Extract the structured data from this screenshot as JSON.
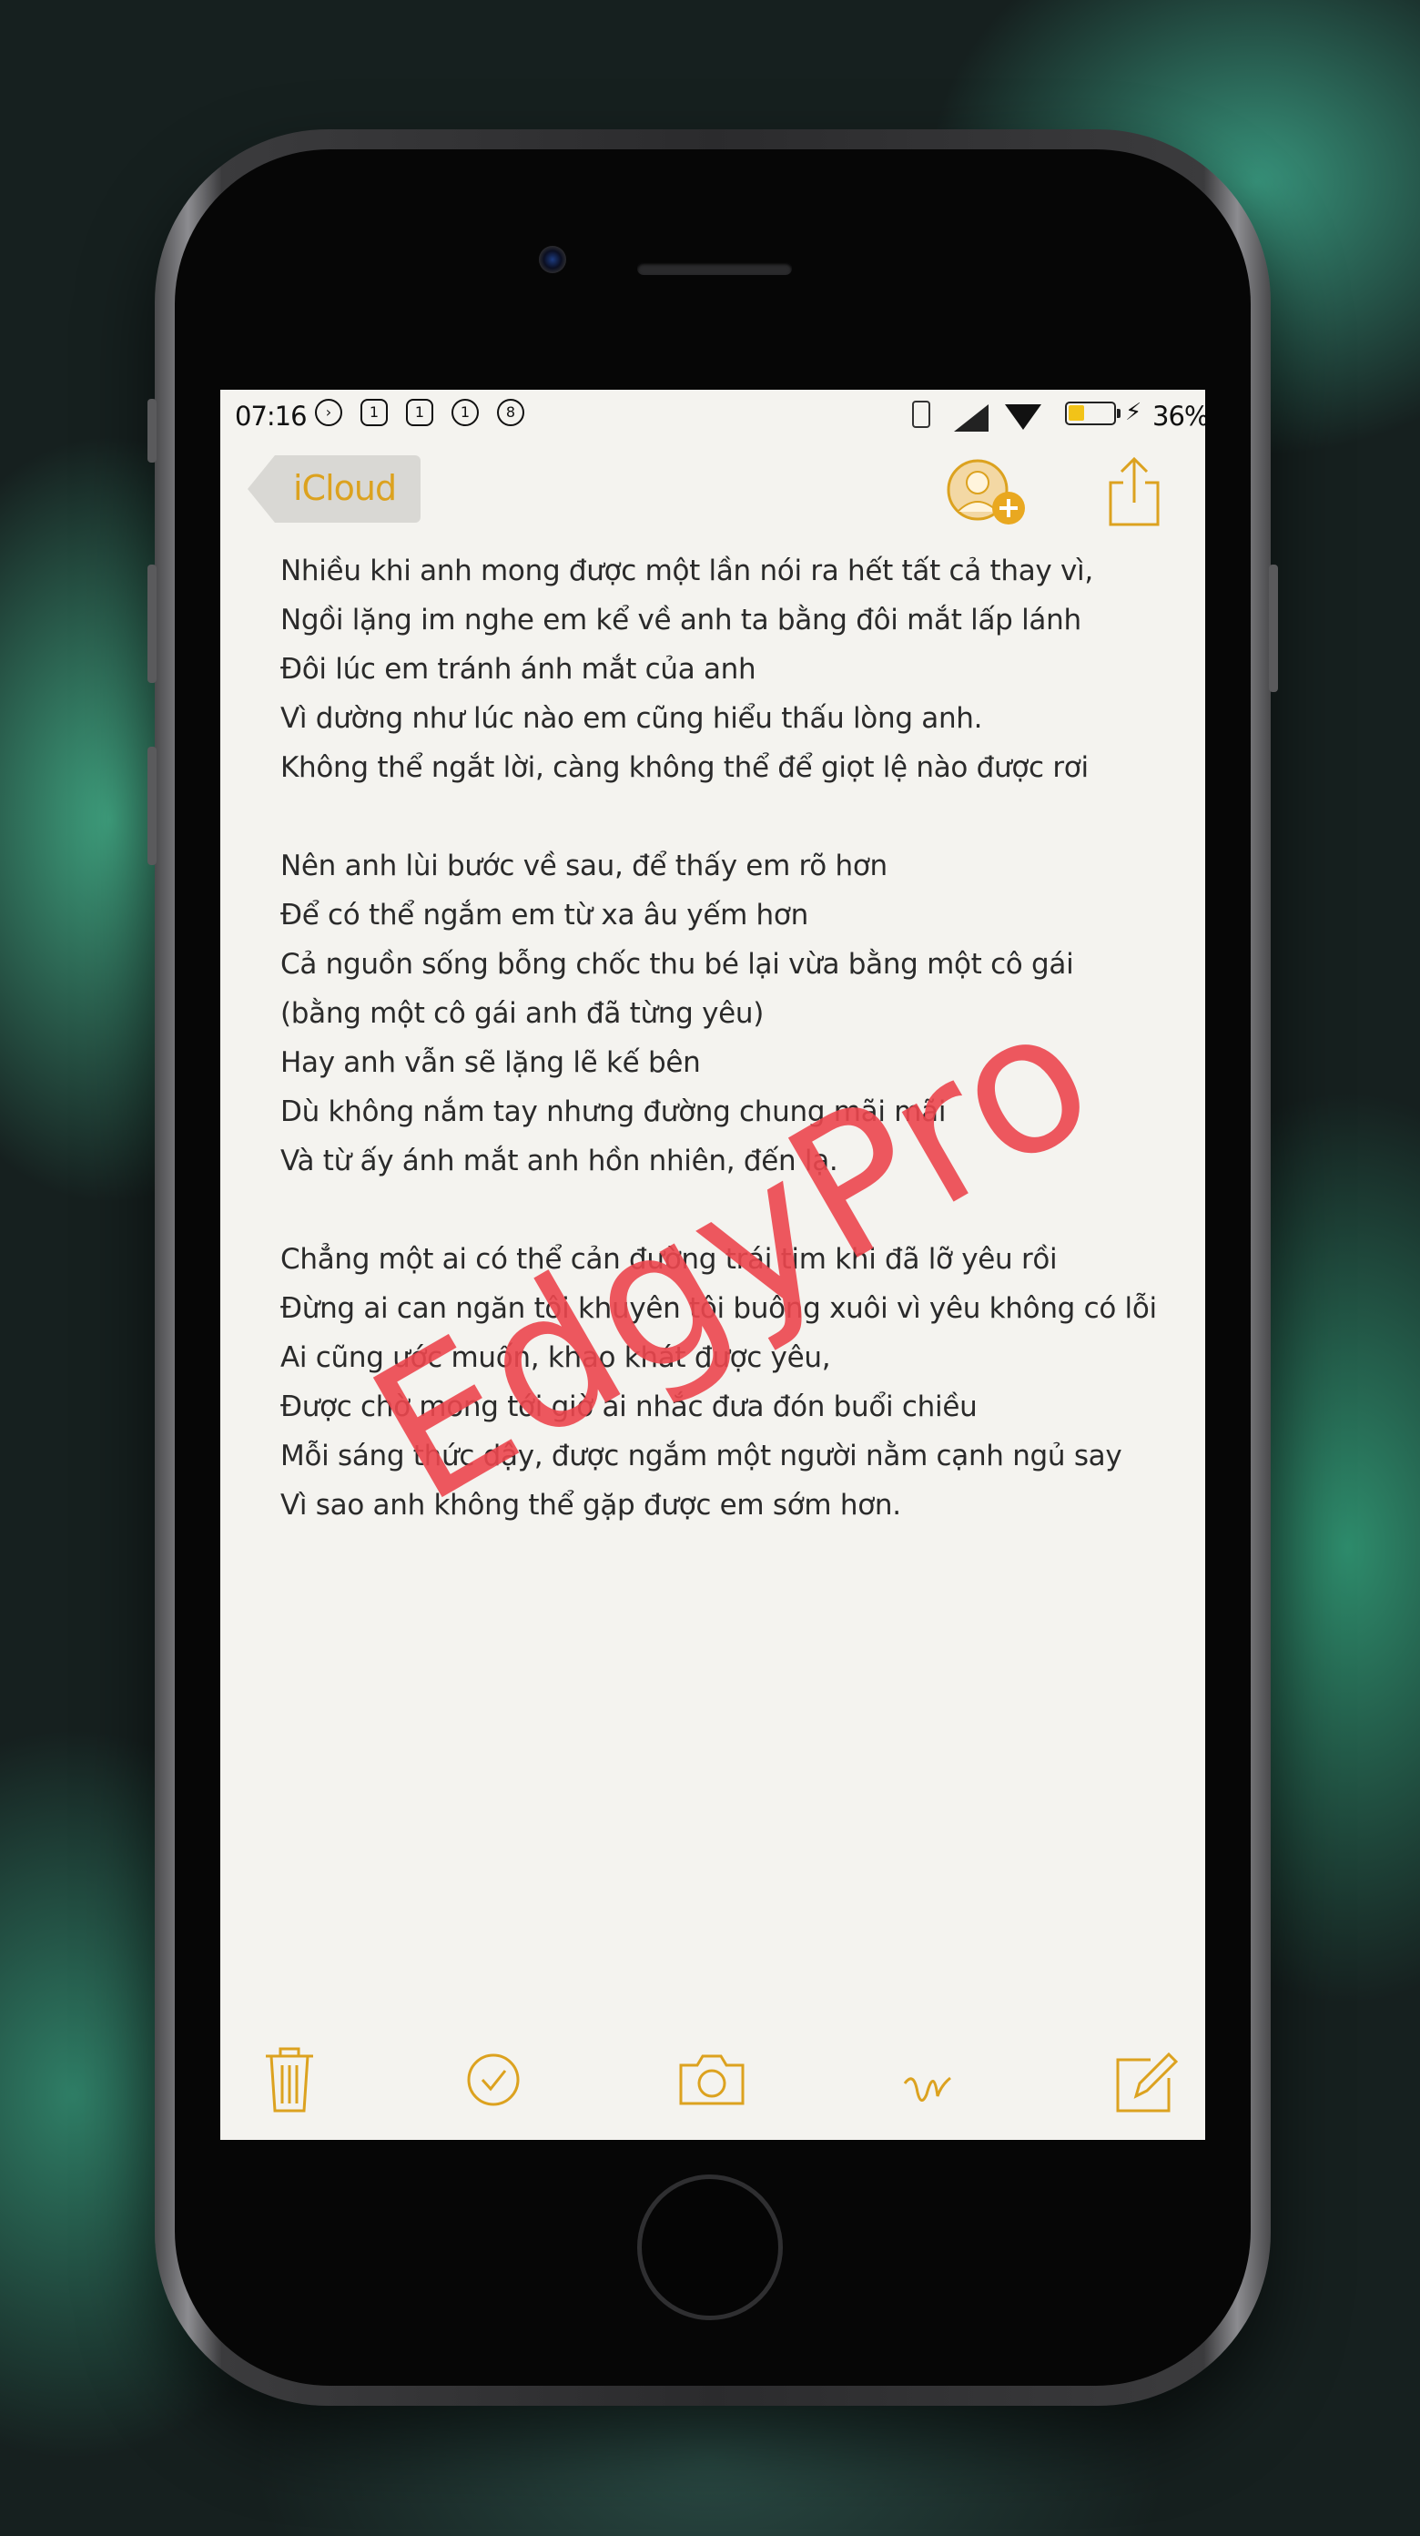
{
  "status_bar": {
    "time": "07:16",
    "notifications": [
      {
        "icon": "play-icon",
        "badge": ""
      },
      {
        "icon": "phone-icon",
        "badge": "1"
      },
      {
        "icon": "message-icon",
        "badge": "1"
      },
      {
        "icon": "chat-icon",
        "badge": "1"
      },
      {
        "icon": "messenger-icon",
        "badge": "8"
      }
    ],
    "battery_percent_text": "36%",
    "battery_level": 0.36,
    "accent": "#f2c318"
  },
  "nav": {
    "back_label": "iCloud",
    "accent": "#dca21f"
  },
  "note": {
    "lines": [
      "Nhiều khi anh mong được một lần nói ra hết tất cả thay vì,",
      "Ngồi lặng im nghe em kể về anh ta bằng đôi mắt lấp lánh",
      "Đôi lúc em tránh ánh mắt của anh",
      "Vì dường như lúc nào em cũng hiểu thấu lòng anh.",
      "Không thể ngắt lời, càng không thể để giọt lệ nào được rơi",
      "",
      "Nên anh lùi bước về sau, để thấy em rõ hơn",
      "Để có thể ngắm em từ xa âu yếm hơn",
      "Cả nguồn sống bỗng chốc thu bé lại vừa bằng một cô gái",
      "(bằng một cô gái anh đã từng yêu)",
      "Hay anh vẫn sẽ lặng lẽ kế bên",
      "Dù không nắm tay nhưng đường chung mãi mãi",
      "Và từ ấy ánh mắt anh hồn nhiên, đến lạ.",
      "",
      "Chẳng một ai có thể cản đường trái tim khi đã lỡ yêu rồi",
      "Đừng ai can ngăn tôi khuyên tôi buông xuôi vì yêu không có lỗi",
      "Ai cũng ước muốn, khao khát được yêu,",
      "Được chờ mong tới giờ ai nhắc đưa đón buổi chiều",
      "Mỗi sáng thức dậy, được ngắm một người nằm cạnh ngủ say",
      "Vì sao anh không thể gặp được em sớm hơn."
    ]
  },
  "watermark": "EdgyPro",
  "toolbar": {
    "items": [
      "trash-icon",
      "checklist-icon",
      "camera-icon",
      "sketch-icon",
      "compose-icon"
    ]
  }
}
